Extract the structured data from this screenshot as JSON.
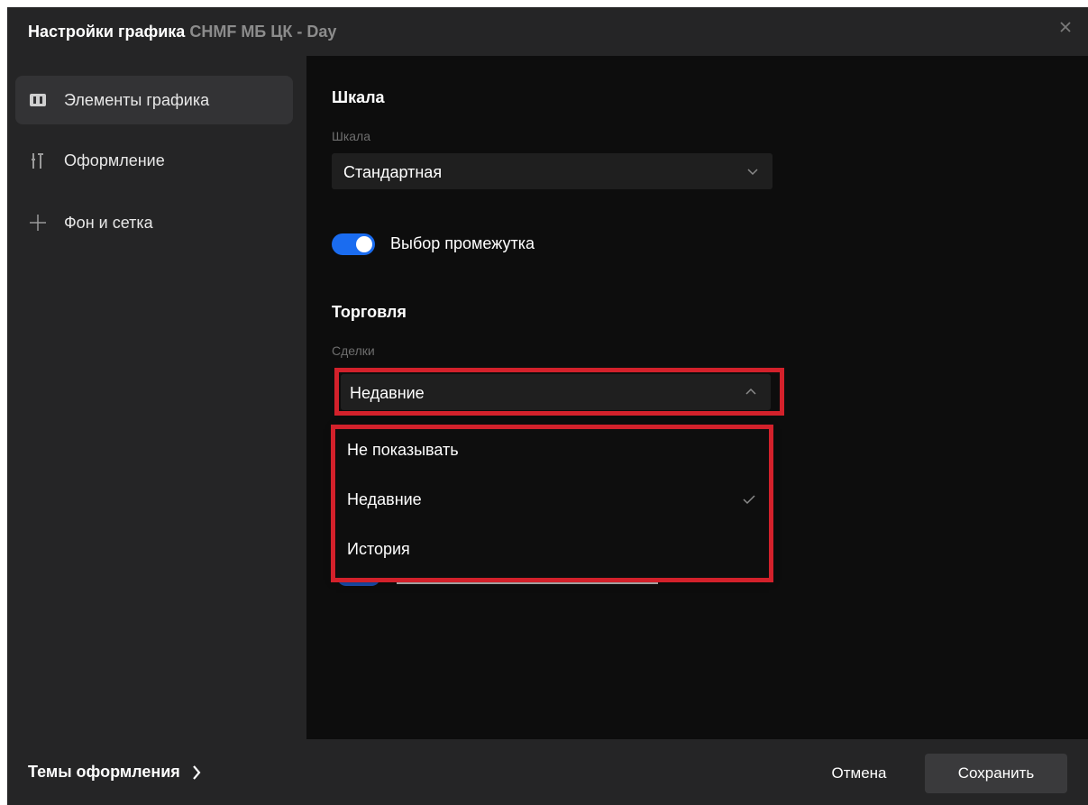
{
  "dialog": {
    "title": "Настройки графика",
    "subject": "CHMF МБ ЦК - Day"
  },
  "sidebar": {
    "items": [
      {
        "label": "Элементы графика",
        "icon": "chart-elements-icon",
        "active": true
      },
      {
        "label": "Оформление",
        "icon": "styling-icon",
        "active": false
      },
      {
        "label": "Фон и сетка",
        "icon": "grid-icon",
        "active": false
      }
    ]
  },
  "scale": {
    "section_title": "Шкала",
    "field_label": "Шкала",
    "value": "Стандартная"
  },
  "range_toggle": {
    "label": "Выбор промежутка",
    "on": true
  },
  "trading": {
    "section_title": "Торговля",
    "field_label": "Сделки",
    "value": "Недавние",
    "options": [
      {
        "label": "Не показывать",
        "selected": false
      },
      {
        "label": "Недавние",
        "selected": true
      },
      {
        "label": "История",
        "selected": false
      }
    ]
  },
  "footer": {
    "themes_label": "Темы оформления",
    "cancel_label": "Отмена",
    "save_label": "Сохранить"
  },
  "colors": {
    "accent": "#1a6cf0",
    "highlight": "#d3212b",
    "panel": "#252526",
    "content_bg": "#0d0d0d"
  }
}
